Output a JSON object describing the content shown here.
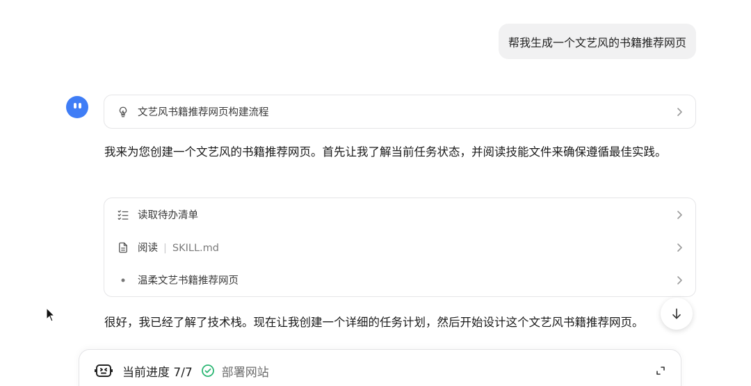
{
  "user_message": "帮我生成一个文艺风的书籍推荐网页",
  "thought": {
    "icon": "lightbulb-icon",
    "label": "文艺风书籍推荐网页构建流程"
  },
  "reply_1": "我来为您创建一个文艺风的书籍推荐网页。首先让我了解当前任务状态，并阅读技能文件来确保遵循最佳实践。",
  "steps": [
    {
      "icon": "checklist-icon",
      "label": "读取待办清单",
      "sub": ""
    },
    {
      "icon": "document-icon",
      "label": "阅读",
      "sub": "SKILL.md"
    },
    {
      "icon": "bullet-icon",
      "label": "温柔文艺书籍推荐网页",
      "sub": ""
    }
  ],
  "reply_2": "很好，我已经了解了技术栈。现在让我创建一个详细的任务计划，然后开始设计这个文艺风书籍推荐网页。",
  "progress": {
    "title": "当前进度 7/7",
    "current_step": "部署网站",
    "status_color": "#2bb673"
  },
  "colors": {
    "accent": "#3f7df6",
    "bubble_bg": "#f1f1f2"
  }
}
